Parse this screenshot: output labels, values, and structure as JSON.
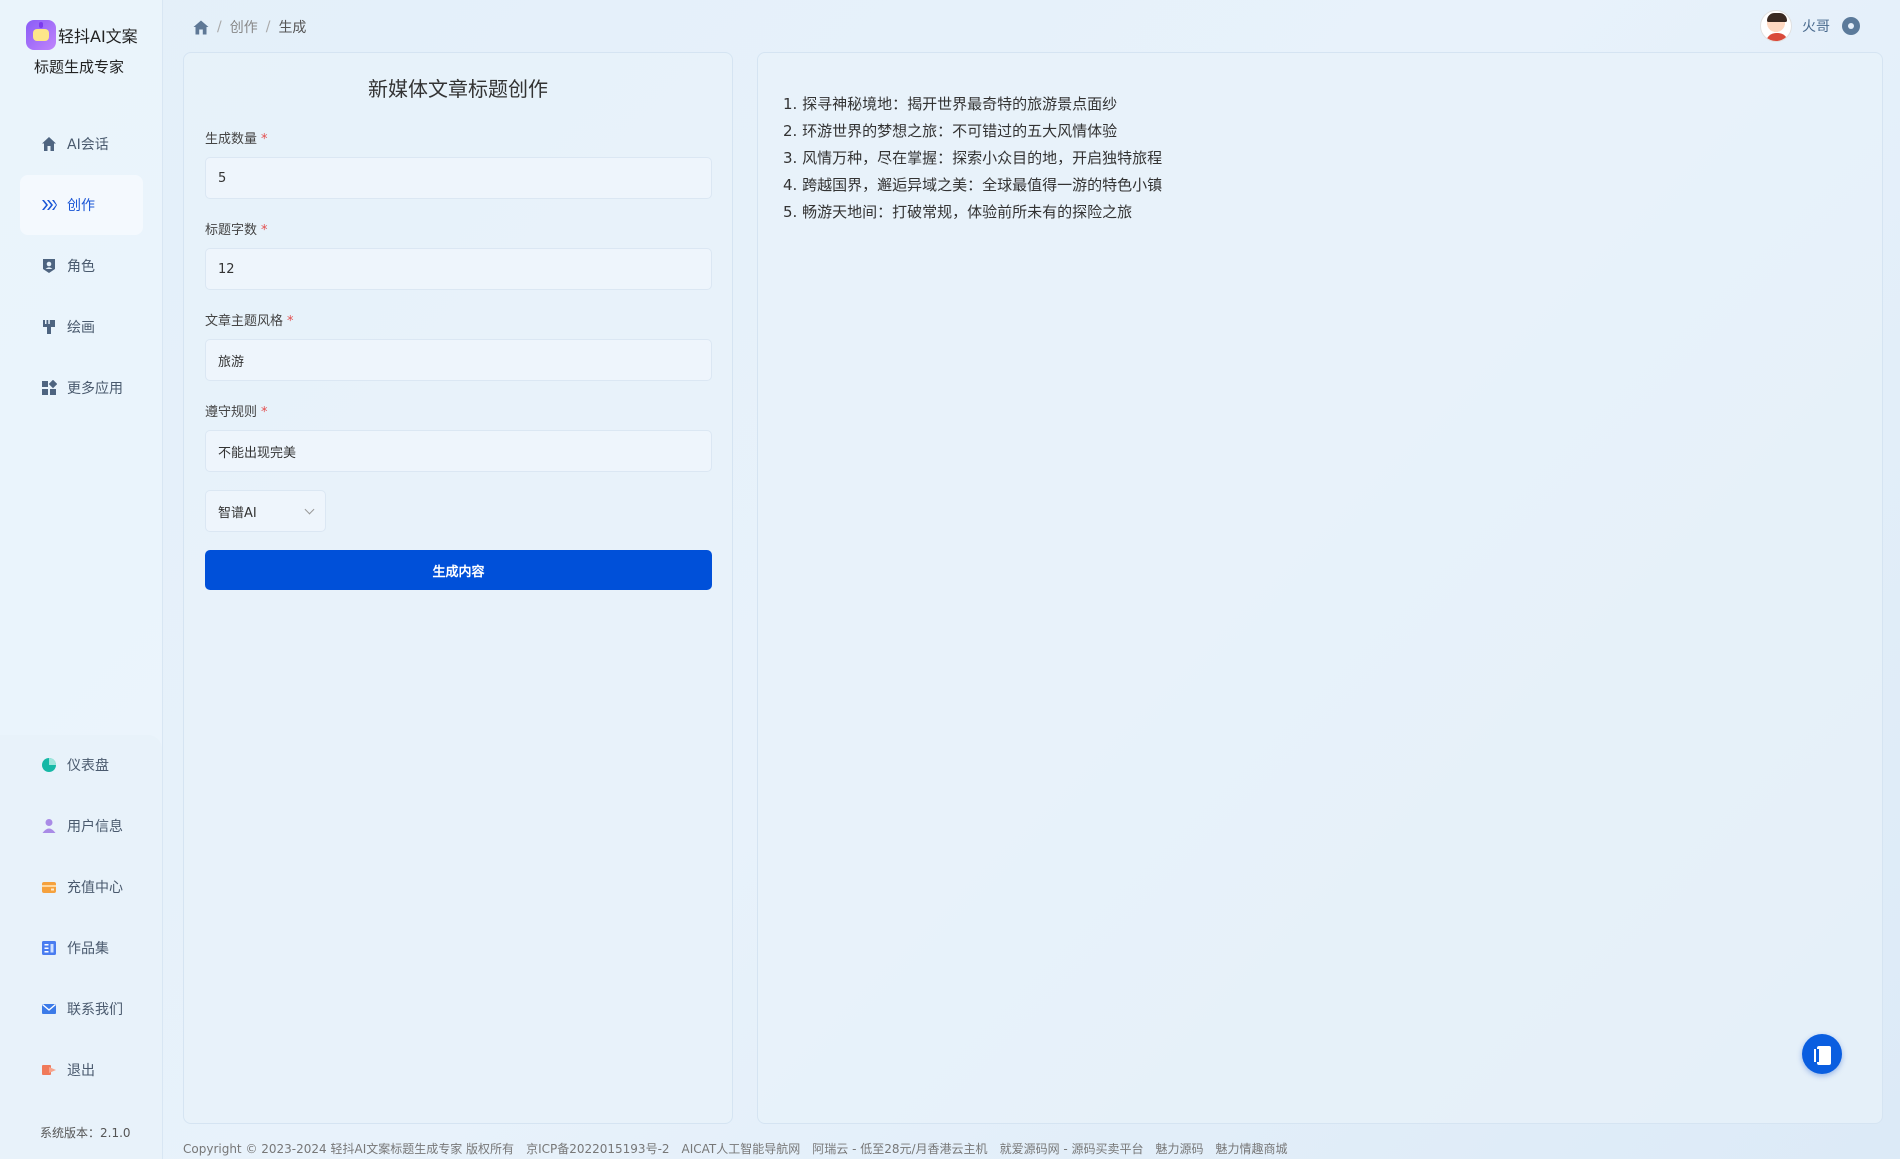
{
  "brand": {
    "title": "轻抖AI文案",
    "subtitle": "标题生成专家"
  },
  "nav": {
    "items": [
      {
        "label": "AI会话",
        "icon": "home-icon"
      },
      {
        "label": "创作",
        "icon": "create-icon"
      },
      {
        "label": "角色",
        "icon": "role-icon"
      },
      {
        "label": "绘画",
        "icon": "brush-icon"
      },
      {
        "label": "更多应用",
        "icon": "apps-icon"
      }
    ],
    "bottom_items": [
      {
        "label": "仪表盘",
        "icon": "dashboard-icon",
        "color": "#16b8a6"
      },
      {
        "label": "用户信息",
        "icon": "user-icon",
        "color": "#a98be6"
      },
      {
        "label": "充值中心",
        "icon": "wallet-icon",
        "color": "#f5a13d"
      },
      {
        "label": "作品集",
        "icon": "book-icon",
        "color": "#4a7df0"
      },
      {
        "label": "联系我们",
        "icon": "mail-icon",
        "color": "#3c7be8"
      },
      {
        "label": "退出",
        "icon": "logout-icon",
        "color": "#f07a5a"
      }
    ],
    "version": "系统版本：2.1.0"
  },
  "breadcrumb": {
    "items": [
      "创作",
      "生成"
    ]
  },
  "user": {
    "name": "火哥"
  },
  "form": {
    "title": "新媒体文章标题创作",
    "fields": [
      {
        "label": "生成数量",
        "value": "5"
      },
      {
        "label": "标题字数",
        "value": "12"
      },
      {
        "label": "文章主题风格",
        "value": "旅游"
      },
      {
        "label": "遵守规则",
        "value": "不能出现完美"
      }
    ],
    "required_mark": "*",
    "model": "智谱AI",
    "submit_label": "生成内容"
  },
  "result": {
    "lines": [
      "1. 探寻神秘境地：揭开世界最奇特的旅游景点面纱",
      "2. 环游世界的梦想之旅：不可错过的五大风情体验",
      "3. 风情万种，尽在掌握：探索小众目的地，开启独特旅程",
      "4. 跨越国界，邂逅异域之美：全球最值得一游的特色小镇",
      "5. 畅游天地间：打破常规，体验前所未有的探险之旅"
    ]
  },
  "footer": {
    "links": [
      "Copyright © 2023-2024 轻抖AI文案标题生成专家 版权所有",
      "京ICP备2022015193号-2",
      "AICAT人工智能导航网",
      "阿瑞云 - 低至28元/月香港云主机",
      "就爱源码网 - 源码买卖平台",
      "魅力源码",
      "魅力情趣商城"
    ]
  },
  "colors": {
    "accent": "#0050d9",
    "active_nav": "#1a56d6",
    "required": "#e34d4d"
  }
}
